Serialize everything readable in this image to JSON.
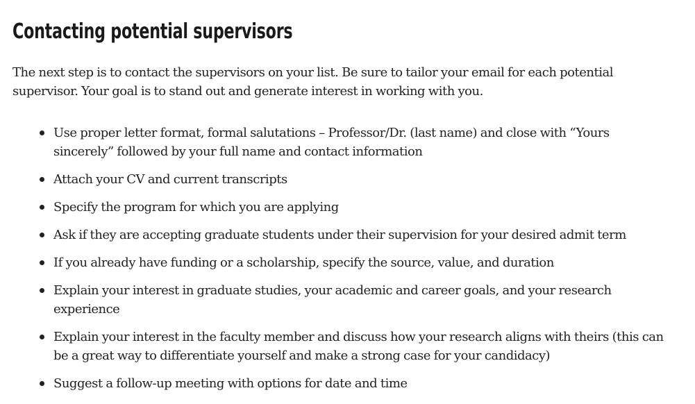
{
  "section": {
    "heading": "Contacting potential supervisors",
    "intro": "The next step is to contact the supervisors on your list. Be sure to tailor your email for each potential supervisor. Your goal is to stand out and generate interest in working with you.",
    "items": [
      "Use proper letter format, formal salutations – Professor/Dr. (last name) and close with “Yours sincerely” followed by your full name and contact information",
      "Attach your CV and current transcripts",
      "Specify the program for which you are applying",
      "Ask if they are accepting graduate students under their supervision for your desired admit term",
      "If you already have funding or a scholarship, specify the source, value, and duration",
      "Explain your interest in graduate studies, your academic and career goals, and your research experience",
      "Explain your interest in the faculty member and discuss how your research aligns with theirs (this can be a great way to differentiate yourself and make a strong case for your candidacy)",
      "Suggest a follow-up meeting with options for date and time"
    ]
  }
}
